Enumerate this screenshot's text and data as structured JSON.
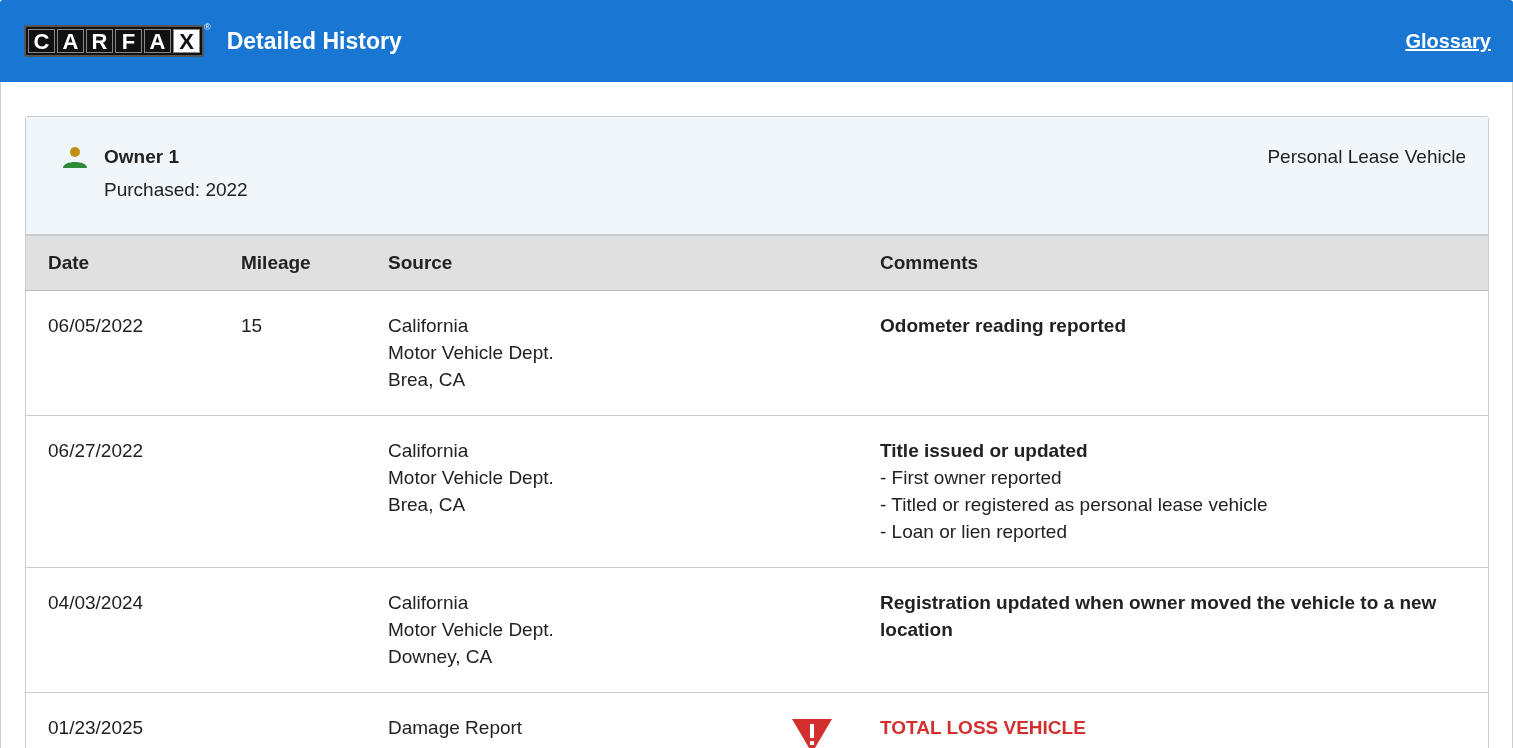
{
  "header": {
    "logo": {
      "letters": [
        "C",
        "A",
        "R",
        "F",
        "A",
        "X"
      ],
      "mark": "®"
    },
    "title": "Detailed History",
    "link": "Glossary"
  },
  "owner": {
    "name": "Owner 1",
    "purchased": "Purchased: 2022",
    "type": "Personal Lease Vehicle"
  },
  "table": {
    "columns": [
      "Date",
      "Mileage",
      "Source",
      "Comments"
    ],
    "rows": [
      {
        "date": "06/05/2022",
        "mileage": "15",
        "source": [
          "California",
          "Motor Vehicle Dept.",
          "Brea, CA"
        ],
        "alert": false,
        "title": "Odometer reading reported",
        "details": []
      },
      {
        "date": "06/27/2022",
        "source": [
          "California",
          "Motor Vehicle Dept.",
          "Brea, CA"
        ],
        "alert": false,
        "title": "Title issued or updated",
        "details": [
          "- First owner reported",
          "- Titled or registered as personal lease vehicle",
          "- Loan or lien reported"
        ]
      },
      {
        "date": "04/03/2024",
        "source": [
          "California",
          "Motor Vehicle Dept.",
          "Downey, CA"
        ],
        "alert": false,
        "title": "Registration updated when owner moved the vehicle to a new location",
        "details": []
      },
      {
        "date": "01/23/2025",
        "source": [
          "Damage Report"
        ],
        "alert": true,
        "title": "TOTAL LOSS VEHICLE",
        "details": []
      }
    ]
  }
}
